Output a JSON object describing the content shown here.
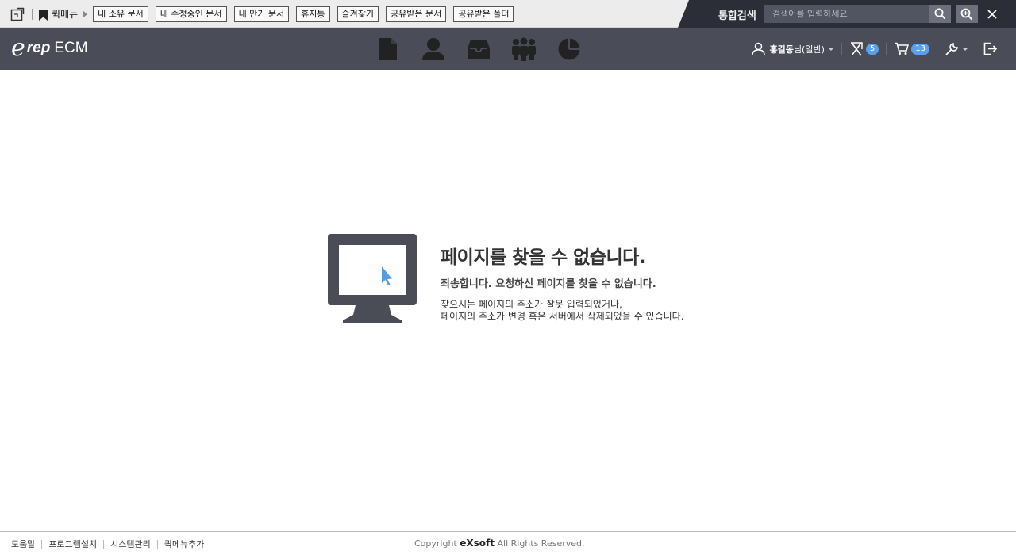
{
  "quickbar": {
    "label": "퀵메뉴",
    "buttons": [
      "내 소유 문서",
      "내 수정중인 문서",
      "내 만기 문서",
      "휴지통",
      "즐겨찾기",
      "공유받은 문서",
      "공유받은 폴더"
    ]
  },
  "search": {
    "label": "통합검색",
    "placeholder": "검색어를 입력하세요"
  },
  "header": {
    "logo_e": "e",
    "logo_rep": "rep",
    "logo_ecm": "ECM",
    "user_name": "홍길동",
    "user_suffix": "님(일반)",
    "approval_count": "5",
    "cart_count": "13",
    "icons": [
      "document-icon",
      "person-icon",
      "inbox-icon",
      "group-icon",
      "pie-chart-icon"
    ]
  },
  "error": {
    "title": "페이지를 찾을 수 없습니다.",
    "subtitle": "죄송합니다. 요청하신 페이지를 찾을 수 없습니다.",
    "desc_line1": "찾으시는 페이지의 주소가 잘못 입력되었거나,",
    "desc_line2": "페이지의 주소가 변경 혹은 서버에서 삭제되었을 수 있습니다."
  },
  "footer": {
    "links": [
      "도움말",
      "프로그램설치",
      "시스템관리",
      "퀵메뉴추가"
    ],
    "copyright_prefix": "Copyright",
    "copyright_brand": "eXsoft",
    "copyright_suffix": "All Rights Reserved."
  },
  "colors": {
    "header_bg": "#4a4d57",
    "search_bg": "#2b2e37",
    "badge": "#5ba0e8",
    "cursor": "#5b9be0"
  }
}
